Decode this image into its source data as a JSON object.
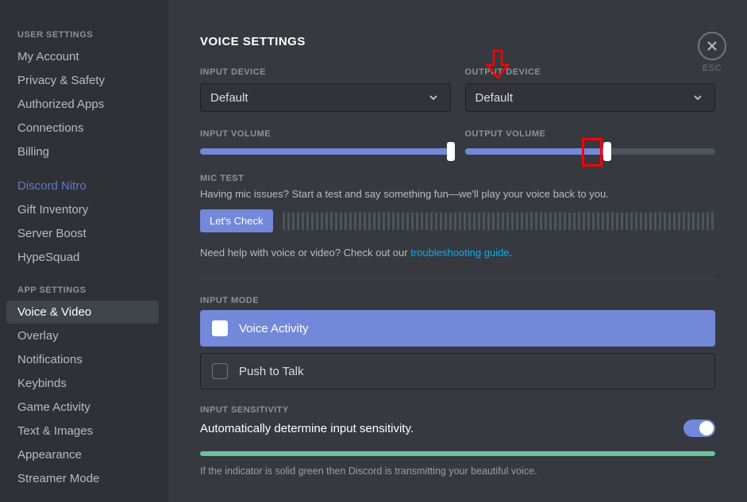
{
  "sidebar": {
    "headings": {
      "user": "USER SETTINGS",
      "app": "APP SETTINGS"
    },
    "user_items": [
      {
        "label": "My Account"
      },
      {
        "label": "Privacy & Safety"
      },
      {
        "label": "Authorized Apps"
      },
      {
        "label": "Connections"
      },
      {
        "label": "Billing"
      }
    ],
    "nitro_items": [
      {
        "label": "Discord Nitro",
        "nitro": true
      },
      {
        "label": "Gift Inventory"
      },
      {
        "label": "Server Boost"
      },
      {
        "label": "HypeSquad"
      }
    ],
    "app_items": [
      {
        "label": "Voice & Video",
        "active": true
      },
      {
        "label": "Overlay"
      },
      {
        "label": "Notifications"
      },
      {
        "label": "Keybinds"
      },
      {
        "label": "Game Activity"
      },
      {
        "label": "Text & Images"
      },
      {
        "label": "Appearance"
      },
      {
        "label": "Streamer Mode"
      }
    ]
  },
  "page": {
    "title": "VOICE SETTINGS",
    "esc": "ESC"
  },
  "input_device": {
    "label": "INPUT DEVICE",
    "value": "Default"
  },
  "output_device": {
    "label": "OUTPUT DEVICE",
    "value": "Default"
  },
  "input_volume": {
    "label": "INPUT VOLUME",
    "percent": 100
  },
  "output_volume": {
    "label": "OUTPUT VOLUME",
    "percent": 57
  },
  "mic_test": {
    "label": "MIC TEST",
    "desc": "Having mic issues? Start a test and say something fun—we'll play your voice back to you.",
    "button": "Let's Check"
  },
  "help": {
    "prefix": "Need help with voice or video? Check out our ",
    "link": "troubleshooting guide",
    "suffix": "."
  },
  "input_mode": {
    "label": "INPUT MODE",
    "options": [
      {
        "label": "Voice Activity",
        "selected": true
      },
      {
        "label": "Push to Talk",
        "selected": false
      }
    ]
  },
  "sensitivity": {
    "label": "INPUT SENSITIVITY",
    "auto_label": "Automatically determine input sensitivity.",
    "auto_on": true,
    "note": "If the indicator is solid green then Discord is transmitting your beautiful voice."
  }
}
